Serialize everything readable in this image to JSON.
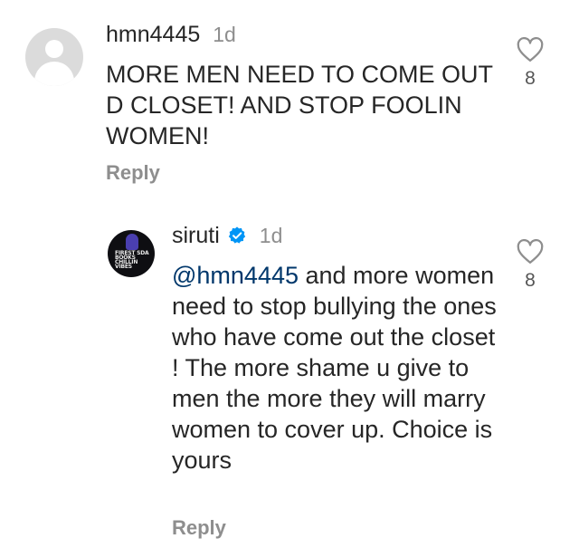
{
  "comments": [
    {
      "username": "hmn4445",
      "time": "1d",
      "text": "MORE MEN NEED TO COME OUT D CLOSET! AND STOP FOOLIN WOMEN!",
      "reply_label": "Reply",
      "likes": "8"
    },
    {
      "username": "siruti",
      "verified": true,
      "time": "1d",
      "mention": "@hmn4445",
      "text": " and more women need to stop bullying the ones who have come out the closet ! The more shame u give to men the more they will marry women to cover up. Choice is yours",
      "reply_label": "Reply",
      "likes": "8",
      "avatar_text": "FIREST SDA BOOKS CHILLIN VIBES"
    }
  ],
  "colors": {
    "text": "#262626",
    "muted": "#8e8e8e",
    "mention": "#00376b",
    "verified": "#0095f6",
    "avatar_placeholder": "#dbdbdb"
  },
  "icons": {
    "like": "heart-outline-icon",
    "verified": "verified-badge-icon"
  }
}
